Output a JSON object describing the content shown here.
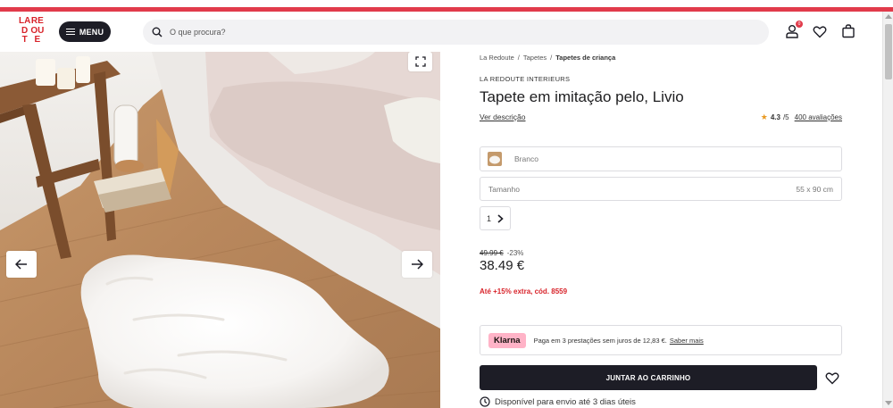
{
  "header": {
    "logo_letters": [
      "LA",
      "RE",
      "D",
      "OU",
      "T",
      "E"
    ],
    "menu_label": "MENU",
    "search_placeholder": "O que procura?",
    "cart_badge": "0"
  },
  "breadcrumb": {
    "items": [
      "La Redoute",
      "Tapetes",
      "Tapetes de criança"
    ]
  },
  "product": {
    "brand": "LA REDOUTE INTERIEURS",
    "title": "Tapete em imitação pelo, Livio",
    "description_link": "Ver descrição",
    "rating": "4.3",
    "rating_max": "/5",
    "reviews": "400 avaliações",
    "color": "Branco",
    "size_label": "Tamanho",
    "size_value": "55 x 90 cm",
    "quantity": "1",
    "old_price": "49.99 €",
    "discount": "-23%",
    "price": "38.49 €",
    "promo": "Até +15% extra, cód. 8559",
    "klarna_logo": "Klarna",
    "klarna_text": "Paga em 3 prestações sem juros de 12,83 €.",
    "klarna_link": "Saber mais",
    "add_to_cart": "JUNTAR AO CARRINHO",
    "availability": "Disponível para envio até 3 dias úteis"
  },
  "colors": {
    "accent": "#e13b4b",
    "dark": "#1d1d26",
    "klarna": "#ffb3c7",
    "star": "#e99a23"
  },
  "icons": [
    "search-icon",
    "user-icon",
    "heart-icon",
    "bag-icon",
    "expand-icon",
    "arrow-left-icon",
    "arrow-right-icon",
    "chevron-right-icon",
    "clock-icon"
  ]
}
